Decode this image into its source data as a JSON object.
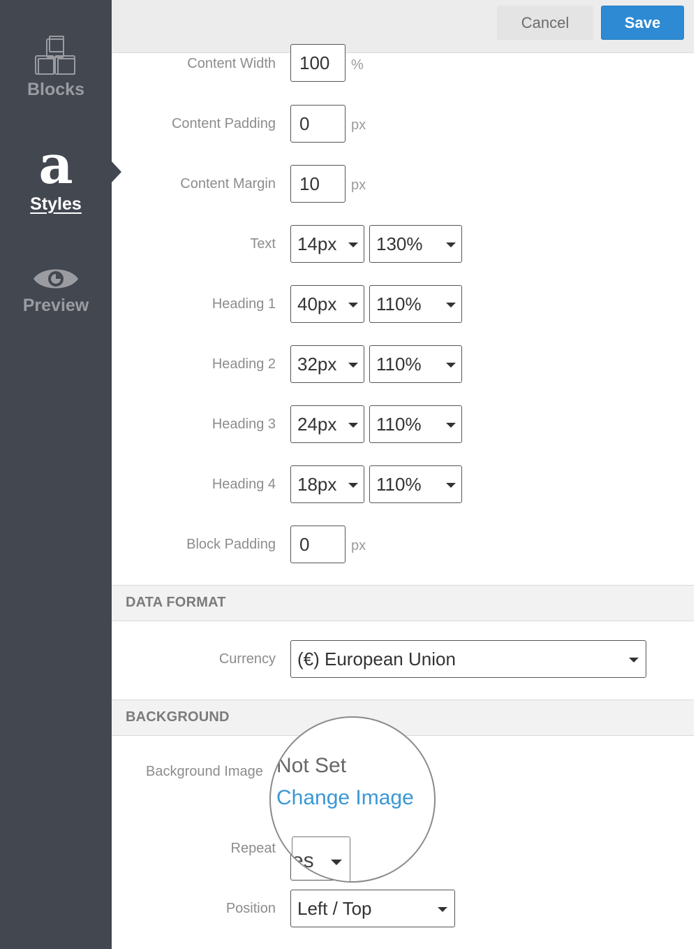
{
  "sidebar": {
    "items": [
      {
        "label": "Blocks",
        "icon": "blocks-icon",
        "active": false
      },
      {
        "label": "Styles",
        "icon": "styles-letter-a-icon",
        "glyph": "a",
        "active": true
      },
      {
        "label": "Preview",
        "icon": "eye-icon",
        "active": false
      }
    ]
  },
  "toolbar": {
    "cancel_label": "Cancel",
    "save_label": "Save",
    "save_color": "#2d8ad3"
  },
  "layout_fields": {
    "content_width": {
      "label": "Content Width",
      "value": "100",
      "unit": "%"
    },
    "content_padding": {
      "label": "Content Padding",
      "value": "0",
      "unit": "px"
    },
    "content_margin": {
      "label": "Content Margin",
      "value": "10",
      "unit": "px"
    }
  },
  "typography": [
    {
      "label": "Text",
      "size": "14px",
      "line_height": "130%"
    },
    {
      "label": "Heading 1",
      "size": "40px",
      "line_height": "110%"
    },
    {
      "label": "Heading 2",
      "size": "32px",
      "line_height": "110%"
    },
    {
      "label": "Heading 3",
      "size": "24px",
      "line_height": "110%"
    },
    {
      "label": "Heading 4",
      "size": "18px",
      "line_height": "110%"
    }
  ],
  "block_padding": {
    "label": "Block Padding",
    "value": "0",
    "unit": "px"
  },
  "data_format": {
    "section_title": "DATA FORMAT",
    "currency_label": "Currency",
    "currency_value": "(€) European Union"
  },
  "background": {
    "section_title": "BACKGROUND",
    "image_label": "Background Image",
    "image_status": "Not Set",
    "change_image_link": "Change Image",
    "link_color": "#3a97d4",
    "repeat_label": "Repeat",
    "repeat_value": "Yes",
    "repeat_value_visible": "es",
    "position_label": "Position",
    "position_value": "Left / Top"
  }
}
